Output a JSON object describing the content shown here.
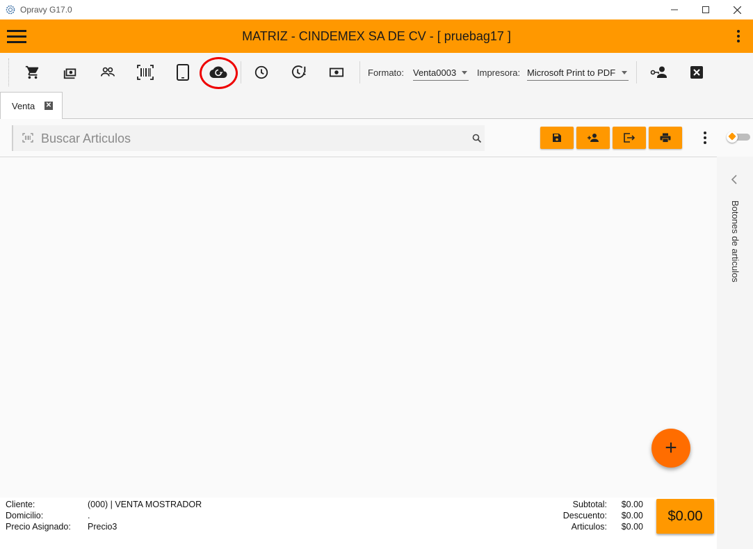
{
  "window": {
    "title": "Opravy G17.0"
  },
  "header": {
    "title": "MATRIZ - CINDEMEX SA DE CV - [ pruebag17 ]"
  },
  "toolbar": {
    "icons": [
      "cart-icon",
      "cash-icon",
      "people-icon",
      "barcode-icon",
      "tablet-icon",
      "cloud-sync-icon",
      "clock-icon",
      "clock-alert-icon",
      "money-icon",
      "user-key-icon",
      "close-box-icon"
    ],
    "formato_label": "Formato:",
    "formato_value": "Venta0003",
    "impresora_label": "Impresora:",
    "impresora_value": "Microsoft Print to PDF"
  },
  "tabs": [
    {
      "label": "Venta",
      "close": "✕"
    }
  ],
  "search": {
    "placeholder": "Buscar Articulos"
  },
  "side_panel": {
    "label": "Botones de articulos"
  },
  "fab": {
    "label": "+"
  },
  "footer": {
    "cliente_label": "Cliente:",
    "cliente_value": "(000) | VENTA MOSTRADOR",
    "domicilio_label": "Domicilio:",
    "domicilio_value": ".",
    "precio_label": "Precio Asignado:",
    "precio_value": "Precio3",
    "subtotal_label": "Subtotal:",
    "subtotal_value": "$0.00",
    "descuento_label": "Descuento:",
    "descuento_value": "$0.00",
    "articulos_label": "Articulos:",
    "articulos_value": "$0.00",
    "total": "$0.00"
  },
  "colors": {
    "accent": "#ff9800",
    "fab": "#ff6d00",
    "highlight": "#e00000"
  }
}
